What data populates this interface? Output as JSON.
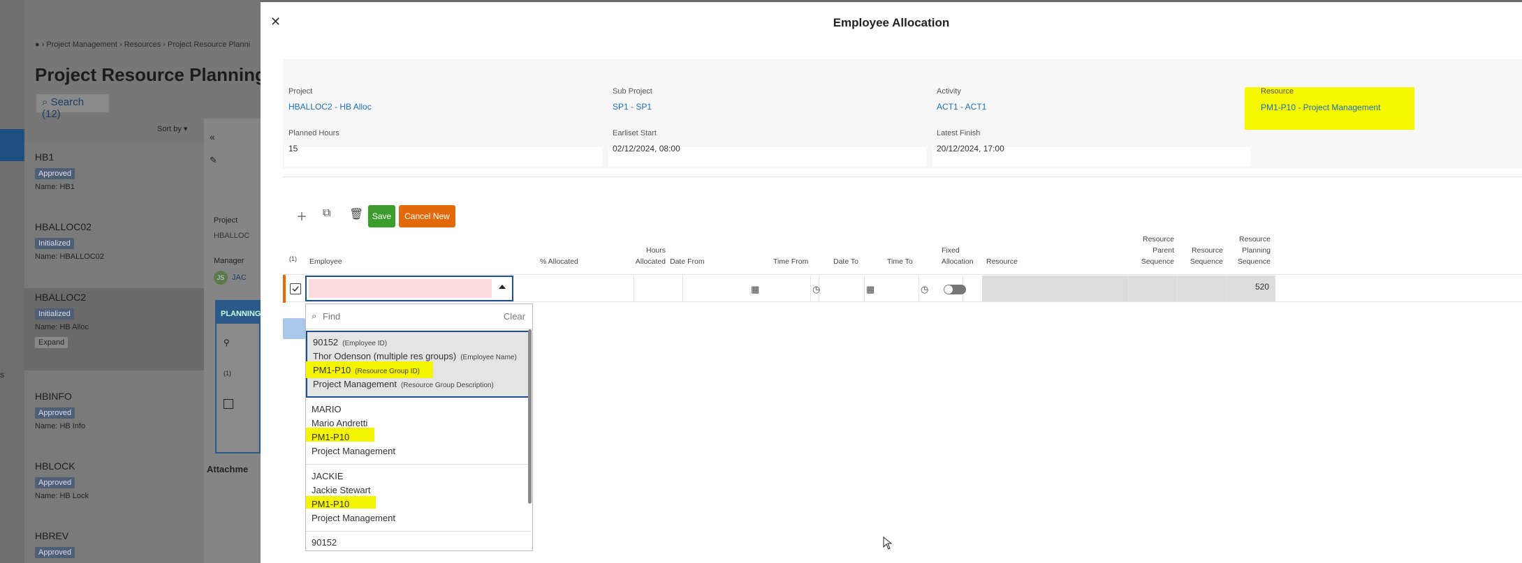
{
  "background": {
    "breadcrumb": "● › Project Management › Resources › Project Resource Planni",
    "page_title": "Project Resource Planning",
    "search_label": "Search (12)",
    "sort_label": "Sort by ▾",
    "side_text": "s",
    "items": [
      {
        "name": "HB1",
        "status": "Approved",
        "detail": "Name:  HB1"
      },
      {
        "name": "HBALLOC02",
        "status": "Initialized",
        "detail": "Name:  HBALLOC02"
      },
      {
        "name": "HBALLOC2",
        "status": "Initialized",
        "detail": "Name:  HB Alloc",
        "expand": "Expand"
      },
      {
        "name": "HBINFO",
        "status": "Approved",
        "detail": "Name:  HB Info"
      },
      {
        "name": "HBLOCK",
        "status": "Approved",
        "detail": "Name:  HB Lock"
      },
      {
        "name": "HBREV",
        "status": "Approved"
      }
    ],
    "panel_project_label": "Project",
    "panel_project_value": "HBALLOC",
    "panel_manager_label": "Manager",
    "panel_manager_initials": "JS",
    "panel_manager_name": "JAC",
    "planning_tab": "PLANNING",
    "attachments": "Attachme",
    "count_label": "(1)"
  },
  "dialog": {
    "title": "Employee Allocation",
    "fields": {
      "project_label": "Project",
      "project_value": "HBALLOC2 - HB Alloc",
      "subproject_label": "Sub Project",
      "subproject_value": "SP1 - SP1",
      "activity_label": "Activity",
      "activity_value": "ACT1 - ACT1",
      "resource_label": "Resource",
      "resource_value": "PM1-P10 - Project Management",
      "planned_hours_label": "Planned Hours",
      "planned_hours_value": "15",
      "earliest_start_label": "Earliset Start",
      "earliest_start_value": "02/12/2024, 08:00",
      "latest_finish_label": "Latest Finish",
      "latest_finish_value": "20/12/2024, 17:00"
    },
    "toolbar": {
      "save_label": "Save",
      "cancel_label": "Cancel New"
    },
    "columns": {
      "count": "(1)",
      "employee": "Employee",
      "pct_allocated": "% Allocated",
      "hours_allocated_1": "Hours",
      "hours_allocated_2": "Allocated",
      "date_from": "Date From",
      "time_from": "Time From",
      "date_to": "Date To",
      "time_to": "Time To",
      "fixed_1": "Fixed",
      "fixed_2": "Allocation",
      "resource": "Resource",
      "rps_1": "Resource",
      "rps_2": "Parent",
      "rps_3": "Sequence",
      "rs_1": "Resource",
      "rs_2": "Sequence",
      "rpls_1": "Resource",
      "rpls_2": "Planning",
      "rpls_3": "Sequence"
    },
    "row": {
      "resource_planning_sequence": "520"
    },
    "dropdown": {
      "find_placeholder": "Find",
      "clear_label": "Clear",
      "options": [
        {
          "id": "90152",
          "id_tag": "(Employee ID)",
          "name": "Thor Odenson (multiple res groups)",
          "name_tag": "(Employee Name)",
          "group": "PM1-P10",
          "group_tag": "(Resource Group ID)",
          "desc": "Project Management",
          "desc_tag": "(Resource Group Description)"
        },
        {
          "id": "MARIO",
          "name": "Mario Andretti",
          "group": "PM1-P10",
          "desc": "Project Management"
        },
        {
          "id": "JACKIE",
          "name": "Jackie Stewart",
          "group": "PM1-P10",
          "desc": "Project Management"
        },
        {
          "id": "90152"
        }
      ]
    }
  },
  "colors": {
    "highlight": "#f5f500",
    "save": "#3c9c2d",
    "cancel": "#e26a0a",
    "link": "#1d6fb8"
  }
}
